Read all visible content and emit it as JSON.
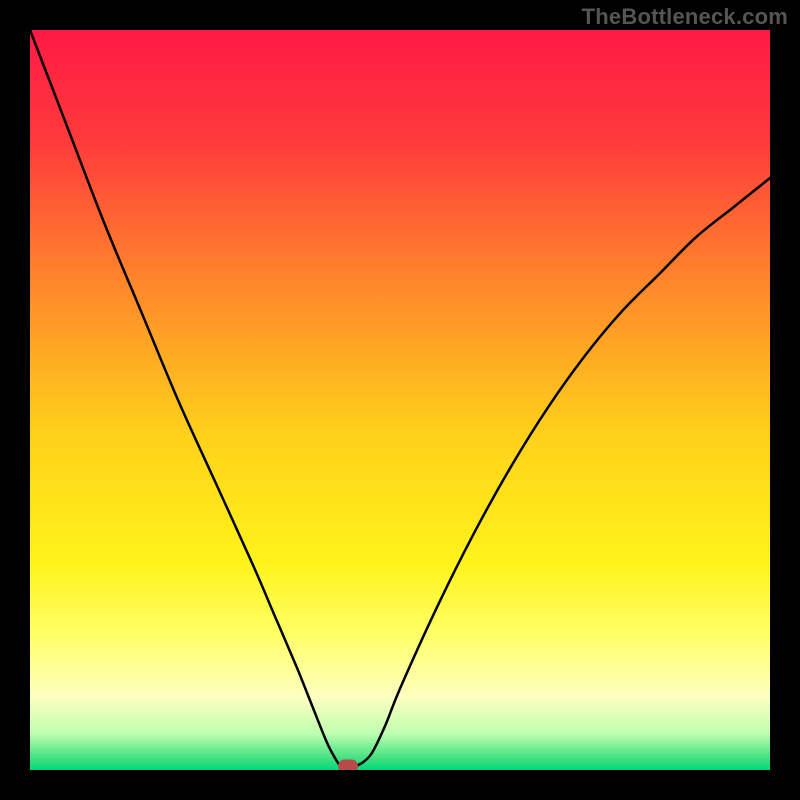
{
  "watermark": "TheBottleneck.com",
  "chart_data": {
    "type": "line",
    "title": "",
    "xlabel": "",
    "ylabel": "",
    "xlim": [
      0,
      100
    ],
    "ylim": [
      0,
      100
    ],
    "background_gradient": {
      "stops": [
        {
          "pos": 0.0,
          "color": "#FF1A44"
        },
        {
          "pos": 0.15,
          "color": "#FF3B3B"
        },
        {
          "pos": 0.35,
          "color": "#FF8A2A"
        },
        {
          "pos": 0.55,
          "color": "#FFD21A"
        },
        {
          "pos": 0.72,
          "color": "#FFF31A"
        },
        {
          "pos": 0.82,
          "color": "#FFFF6A"
        },
        {
          "pos": 0.9,
          "color": "#FFFFC0"
        },
        {
          "pos": 0.95,
          "color": "#C0FFB0"
        },
        {
          "pos": 0.985,
          "color": "#40E080"
        },
        {
          "pos": 1.0,
          "color": "#00D878"
        }
      ]
    },
    "series": [
      {
        "name": "bottleneck-curve",
        "x": [
          0,
          5,
          10,
          15,
          20,
          25,
          30,
          33,
          36,
          38,
          40,
          41,
          42,
          43,
          44,
          46,
          48,
          50,
          55,
          60,
          65,
          70,
          75,
          80,
          85,
          90,
          95,
          100
        ],
        "y": [
          100,
          87,
          74,
          62,
          50,
          39,
          28,
          21,
          14,
          9,
          4,
          2,
          0.5,
          0.5,
          0.5,
          2,
          6,
          11,
          22,
          32,
          41,
          49,
          56,
          62,
          67,
          72,
          76,
          80
        ]
      }
    ],
    "marker": {
      "x": 43,
      "y": 0.5,
      "color": "#b94a4a"
    }
  }
}
